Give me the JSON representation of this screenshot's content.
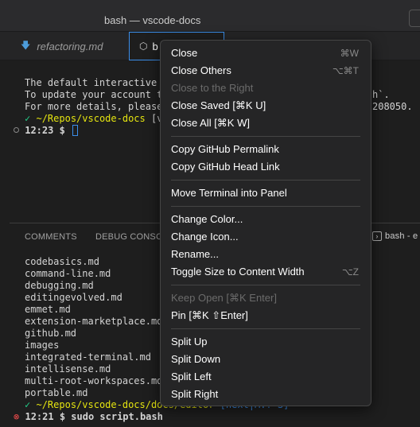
{
  "window": {
    "title": "bash — vscode-docs"
  },
  "tabs": [
    {
      "label": "refactoring.md",
      "icon": "markdown-arrow-icon"
    },
    {
      "label": "b",
      "icon": "terminal-box-icon"
    }
  ],
  "terminal_top": {
    "line1": "The default interactive",
    "line2": "To update your account t",
    "line2_end": "h`.",
    "line3": "For more details, please",
    "line3_end": "208050.",
    "prompt_check": "✓",
    "prompt_path": "~/Repos/vscode-docs",
    "prompt_branch_partial": "[v",
    "prompt_time": "12:23 $"
  },
  "panel": {
    "tab_comments": "COMMENTS",
    "tab_debug": "DEBUG CONSC",
    "tab_bash": "bash - e"
  },
  "terminal_bottom": {
    "files": [
      "codebasics.md",
      "command-line.md",
      "debugging.md",
      "editingevolved.md",
      "emmet.md",
      "extension-marketplace.md",
      "github.md",
      "images",
      "integrated-terminal.md",
      "intellisense.md",
      "multi-root-workspaces.md",
      "portable.md"
    ],
    "prompt_path": "~/Repos/vscode-docs/docs/editor",
    "prompt_branch": "[next|M:? S]",
    "error_mark": "⊗",
    "last_command": "12:21 $ sudo script.bash"
  },
  "context_menu": {
    "groups": [
      [
        {
          "label": "Close",
          "shortcut": "⌘W",
          "disabled": false
        },
        {
          "label": "Close Others",
          "shortcut": "⌥⌘T",
          "disabled": false
        },
        {
          "label": "Close to the Right",
          "shortcut": "",
          "disabled": true
        },
        {
          "label": "Close Saved [⌘K U]",
          "shortcut": "",
          "disabled": false
        },
        {
          "label": "Close All [⌘K W]",
          "shortcut": "",
          "disabled": false
        }
      ],
      [
        {
          "label": "Copy GitHub Permalink",
          "shortcut": "",
          "disabled": false
        },
        {
          "label": "Copy GitHub Head Link",
          "shortcut": "",
          "disabled": false
        }
      ],
      [
        {
          "label": "Move Terminal into Panel",
          "shortcut": "",
          "disabled": false
        }
      ],
      [
        {
          "label": "Change Color...",
          "shortcut": "",
          "disabled": false
        },
        {
          "label": "Change Icon...",
          "shortcut": "",
          "disabled": false
        },
        {
          "label": "Rename...",
          "shortcut": "",
          "disabled": false
        },
        {
          "label": "Toggle Size to Content Width",
          "shortcut": "⌥Z",
          "disabled": false
        }
      ],
      [
        {
          "label": "Keep Open [⌘K Enter]",
          "shortcut": "",
          "disabled": true
        },
        {
          "label": "Pin [⌘K ⇧Enter]",
          "shortcut": "",
          "disabled": false
        }
      ],
      [
        {
          "label": "Split Up",
          "shortcut": "",
          "disabled": false
        },
        {
          "label": "Split Down",
          "shortcut": "",
          "disabled": false
        },
        {
          "label": "Split Left",
          "shortcut": "",
          "disabled": false
        },
        {
          "label": "Split Right",
          "shortcut": "",
          "disabled": false
        }
      ]
    ]
  },
  "colors": {
    "background": "#1e1e1e",
    "menu_background": "#252526",
    "accent_blue": "#3b8eea",
    "prompt_green": "#23d18b",
    "prompt_yellow": "#e5e510",
    "error_red": "#f14c4c"
  }
}
